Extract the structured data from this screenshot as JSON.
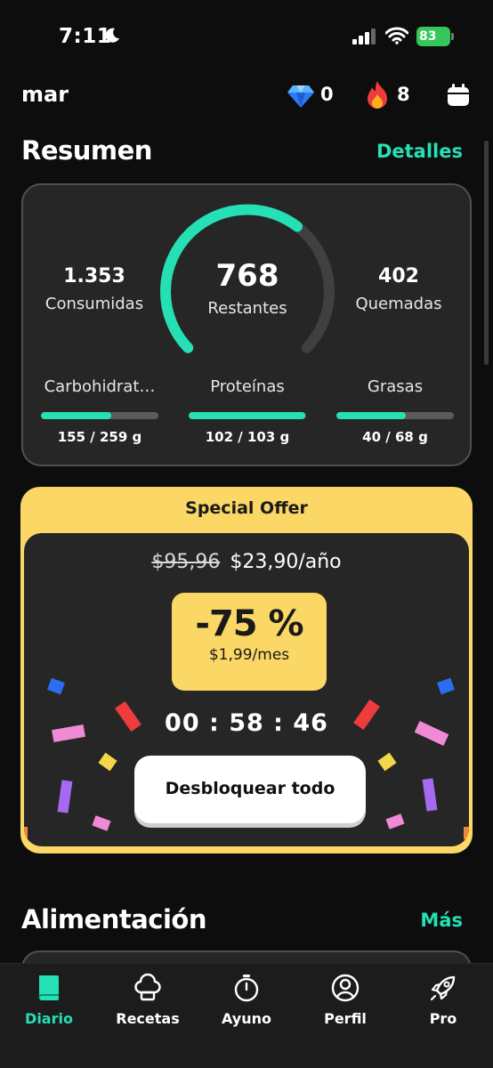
{
  "status_bar": {
    "time": "7:11",
    "battery": "83"
  },
  "header": {
    "day": "mar",
    "gems": "0",
    "streak": "8"
  },
  "summary": {
    "title": "Resumen",
    "link": "Detalles",
    "consumed_value": "1.353",
    "consumed_label": "Consumidas",
    "remaining_value": "768",
    "remaining_label": "Restantes",
    "burned_value": "402",
    "burned_label": "Quemadas",
    "gauge_progress": 0.64,
    "macros": [
      {
        "name": "Carbohidrat…",
        "amount": "155 / 259 g",
        "progress": 0.6
      },
      {
        "name": "Proteínas",
        "amount": "102 / 103 g",
        "progress": 0.99
      },
      {
        "name": "Grasas",
        "amount": "40 / 68 g",
        "progress": 0.59
      }
    ]
  },
  "offer": {
    "title": "Special Offer",
    "old_price": "$95,96",
    "new_price": "$23,90/año",
    "discount": "-75 %",
    "monthly": "$1,99/mes",
    "countdown": "00 : 58 : 46",
    "cta": "Desbloquear todo"
  },
  "feed": {
    "title": "Alimentación",
    "link": "Más"
  },
  "tabs": [
    {
      "label": "Diario",
      "icon": "book-icon",
      "active": true
    },
    {
      "label": "Recetas",
      "icon": "chef-hat-icon",
      "active": false
    },
    {
      "label": "Ayuno",
      "icon": "stopwatch-icon",
      "active": false
    },
    {
      "label": "Perfil",
      "icon": "profile-icon",
      "active": false
    },
    {
      "label": "Pro",
      "icon": "rocket-icon",
      "active": false
    }
  ],
  "colors": {
    "accent": "#24e0b4",
    "offer": "#fbd765",
    "card": "#262626",
    "background": "#0d0d0d"
  }
}
